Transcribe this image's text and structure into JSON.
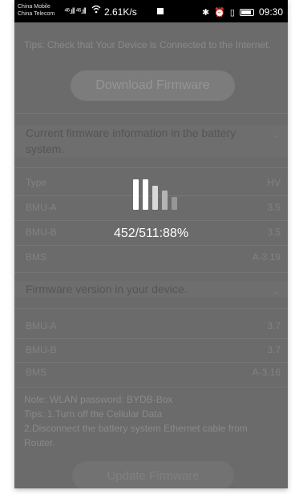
{
  "status_bar": {
    "carrier_1": "China Mobile",
    "carrier_2": "China Telecom",
    "signal": "⁴⁶.ıll ⁴⁶.ıll",
    "net_speed": "2.61K/s",
    "time": "09:30"
  },
  "content": {
    "tips_top": "Tips: Check that Your Device is Connected to the Internet.",
    "download_button": "Download Firmware",
    "battery_section": {
      "title": "Current firmware information in the battery system.",
      "rows": [
        {
          "key": "Type",
          "value": "HV"
        },
        {
          "key": "BMU-A",
          "value": "3.5"
        },
        {
          "key": "BMU-B",
          "value": "3.5"
        },
        {
          "key": "BMS",
          "value": "A-3.19"
        }
      ]
    },
    "device_section": {
      "title": "Firmware version in your device.",
      "rows": [
        {
          "key": "BMU-A",
          "value": "3.7"
        },
        {
          "key": "BMU-B",
          "value": "3.7"
        },
        {
          "key": "BMS",
          "value": "A-3.16"
        }
      ]
    },
    "notes": {
      "note_wlan": "Note: WLAN password: BYDB-Box",
      "tip_1": "Tips: 1.Turn off the Cellular Data",
      "tip_2": "2.Disconnect the battery system Ethernet cable from Router."
    },
    "update_button": "Update Firmware"
  },
  "loading": {
    "progress_text": "452/511:88%",
    "bar_colors": [
      "#ffffff",
      "#ffffff",
      "#d8d8d8",
      "#b4b4b4",
      "#969696"
    ]
  }
}
